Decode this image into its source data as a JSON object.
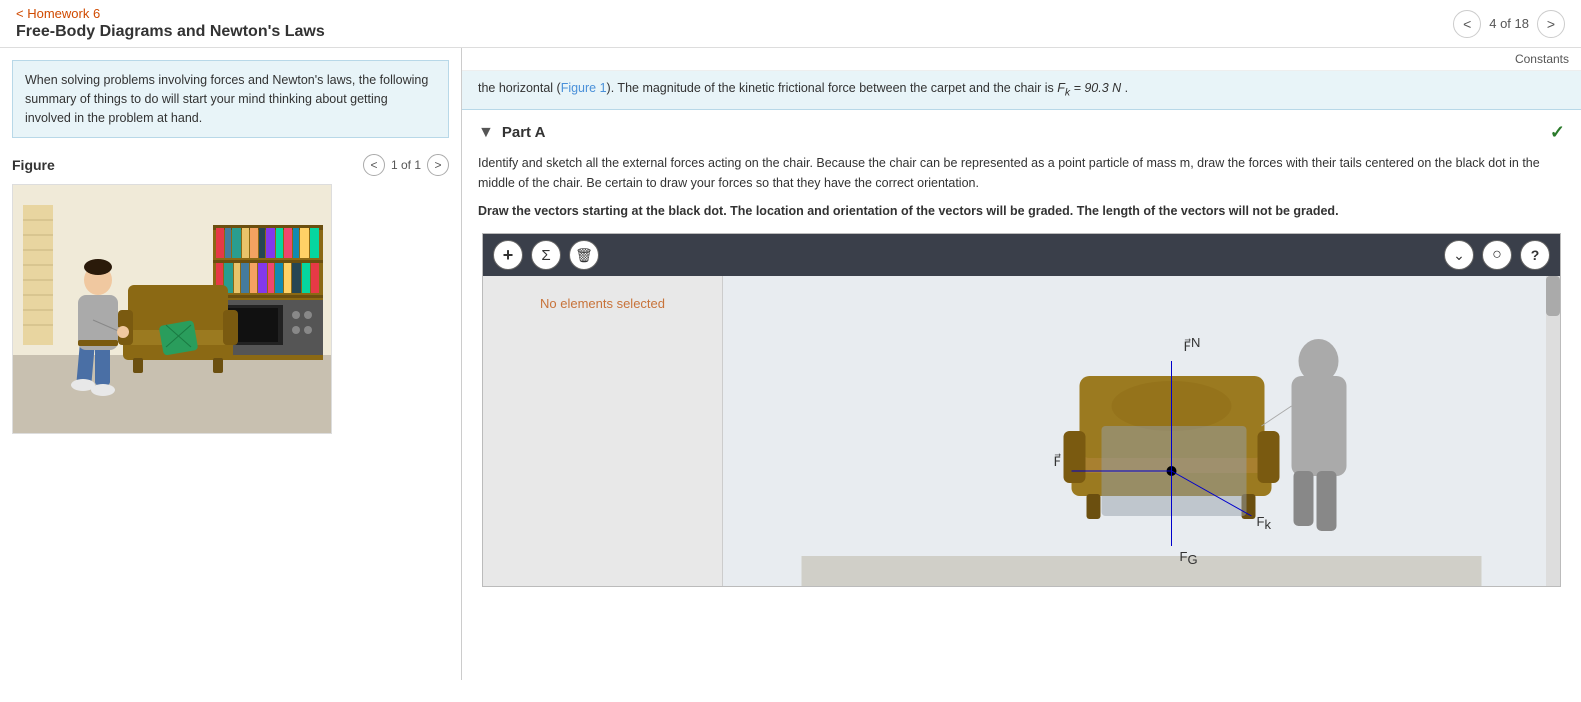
{
  "header": {
    "back_link": "< Homework 6",
    "title": "Free-Body Diagrams and Newton's Laws",
    "nav": {
      "prev_label": "<",
      "next_label": ">",
      "current": "4",
      "total": "18",
      "display": "4 of 18"
    }
  },
  "sidebar": {
    "hint": "When solving problems involving forces and Newton's laws, the following summary of things to do will start your mind thinking about getting involved in the problem at hand.",
    "figure": {
      "label": "Figure",
      "counter": "1 of 1",
      "prev": "<",
      "next": ">"
    }
  },
  "constants": {
    "label": "Constants"
  },
  "problem": {
    "text": "the horizontal (Figure 1). The magnitude of the kinetic frictional force between the carpet and the chair is",
    "formula_prefix": "F",
    "formula_sub": "k",
    "formula_value": "= 90.3 N"
  },
  "part_a": {
    "label": "Part A",
    "check_mark": "✓",
    "instruction": "Identify and sketch all the external forces acting on the chair. Because the chair can be represented as a point particle of mass m, draw the forces with their tails centered on the black dot in the middle of the chair. Be certain to draw your forces so that they have the correct orientation.",
    "bold_instruction": "Draw the vectors starting at the black dot. The location and orientation of the vectors will be graded. The length of the vectors will not be graded."
  },
  "canvas": {
    "toolbar": {
      "add_btn": "+",
      "sigma_btn": "Σ",
      "delete_btn": "🗑",
      "dropdown_btn": "⌄",
      "circle_btn": "○",
      "help_btn": "?"
    },
    "no_elements_text": "No elements selected"
  },
  "colors": {
    "back_link": "#d04a00",
    "accent_blue": "#4a90d9",
    "part_check": "#2a7a2a",
    "toolbar_bg": "#3a3f4a",
    "hint_bg": "#e8f4f8",
    "canvas_left_bg": "#e8e8e8",
    "canvas_right_bg": "#e8ecf0",
    "no_elements_color": "#c8733a"
  }
}
